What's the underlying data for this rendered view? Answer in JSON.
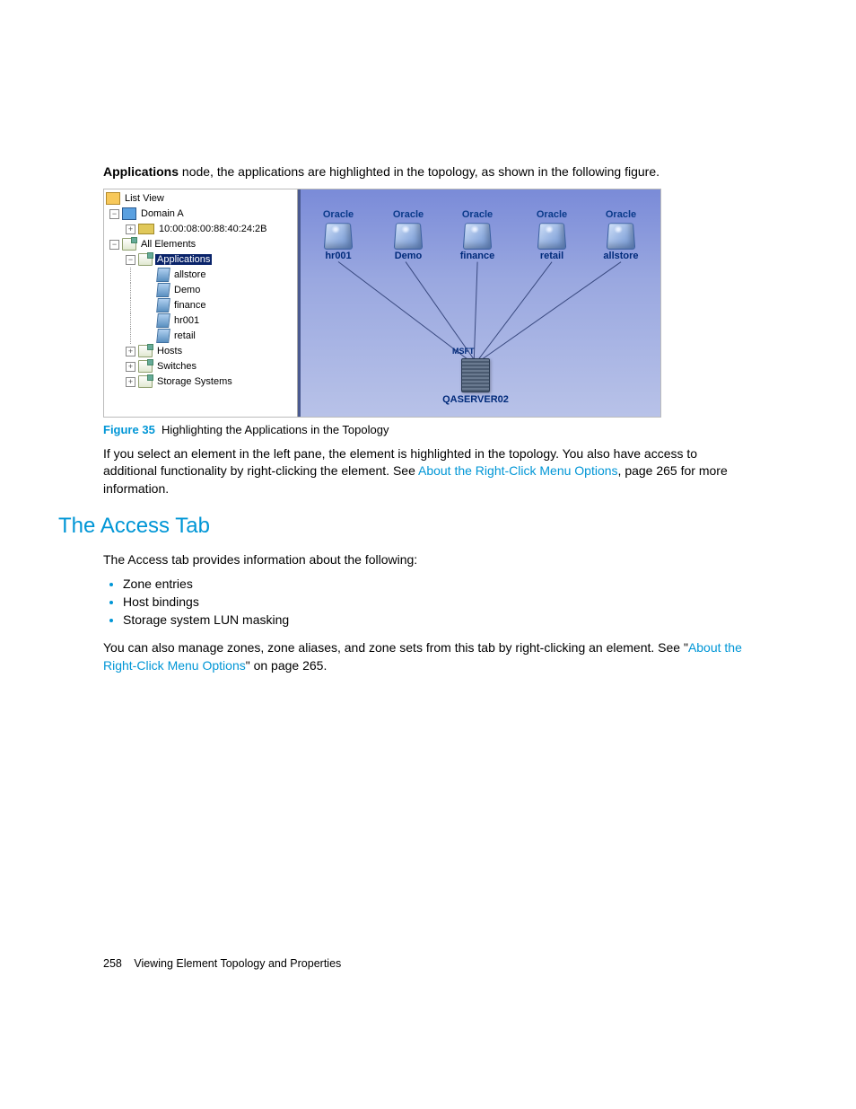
{
  "intro": {
    "bold_word": "Applications",
    "rest": " node, the applications are highlighted in the topology, as shown in the following figure."
  },
  "tree": {
    "root": "List View",
    "domain": "Domain A",
    "switch_id": "10:00:08:00:88:40:24:2B",
    "all_elements": "All Elements",
    "applications": "Applications",
    "apps": [
      "allstore",
      "Demo",
      "finance",
      "hr001",
      "retail"
    ],
    "hosts": "Hosts",
    "switches": "Switches",
    "storage": "Storage Systems"
  },
  "topology": {
    "app_label": "Oracle",
    "apps": [
      {
        "name": "hr001"
      },
      {
        "name": "Demo"
      },
      {
        "name": "finance"
      },
      {
        "name": "retail"
      },
      {
        "name": "allstore"
      }
    ],
    "server_badge": "MSFT",
    "server_name": "QASERVER02"
  },
  "figure": {
    "number": "Figure 35",
    "caption": "Highlighting the Applications in the Topology"
  },
  "para2": {
    "pre": "If you select an element in the left pane, the element is highlighted in the topology. You also have access to additional functionality by right-clicking the element. See ",
    "link": "About the Right-Click Menu Options",
    "post": ", page 265 for more information."
  },
  "section": {
    "heading": "The Access Tab",
    "intro": "The Access tab provides information about the following:",
    "bullets": [
      "Zone entries",
      "Host bindings",
      "Storage system LUN masking"
    ],
    "closing_pre": "You can also manage zones, zone aliases, and zone sets from this tab by right-clicking an element. See \"",
    "closing_link": "About the Right-Click Menu Options",
    "closing_post": "\" on page 265."
  },
  "footer": {
    "page_number": "258",
    "chapter": "Viewing Element Topology and Properties"
  }
}
